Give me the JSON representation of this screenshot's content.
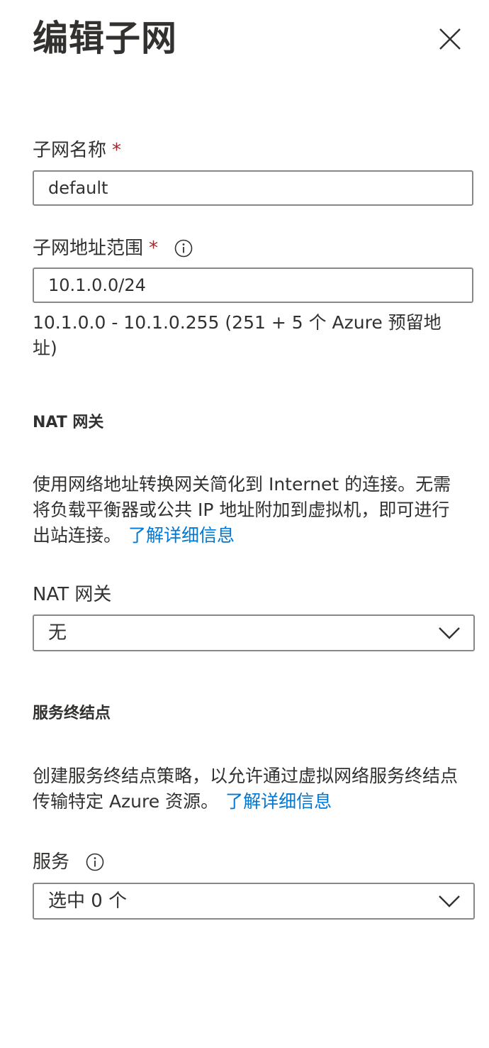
{
  "header": {
    "title": "编辑子网",
    "close_icon": "close-icon"
  },
  "subnet_name": {
    "label": "子网名称",
    "required_mark": "*",
    "value": "default"
  },
  "address_range": {
    "label": "子网地址范围",
    "required_mark": "*",
    "info_icon": "info-icon",
    "value": "10.1.0.0/24",
    "hint": "10.1.0.0 - 10.1.0.255 (251 + 5 个 Azure 预留地址)"
  },
  "nat_section": {
    "heading": "NAT 网关",
    "description": "使用网络地址转换网关简化到 Internet 的连接。无需将负载平衡器或公共 IP 地址附加到虚拟机，即可进行出站连接。",
    "learn_more": "了解详细信息",
    "field_label": "NAT 网关",
    "selected_value": "无",
    "chevron_icon": "chevron-down-icon"
  },
  "endpoints_section": {
    "heading": "服务终结点",
    "description": "创建服务终结点策略，以允许通过虚拟网络服务终结点传输特定 Azure 资源。",
    "learn_more": "了解详细信息",
    "field_label": "服务",
    "info_icon": "info-icon",
    "selected_value": "选中 0 个",
    "chevron_icon": "chevron-down-icon"
  },
  "colors": {
    "text": "#323130",
    "required": "#a4262c",
    "link": "#0078d4",
    "border": "#8a8886"
  }
}
